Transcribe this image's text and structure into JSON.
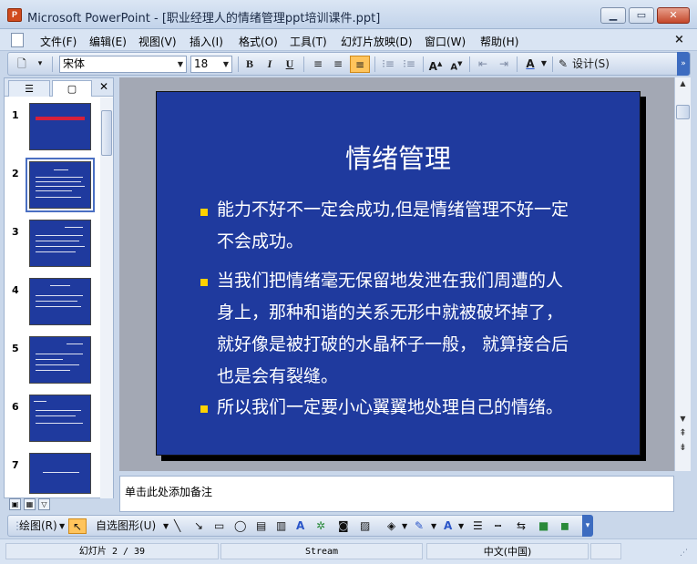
{
  "window": {
    "title": "Microsoft PowerPoint - [职业经理人的情绪管理ppt培训课件.ppt]",
    "app_icon_text": "P"
  },
  "menu": {
    "items": [
      "文件(F)",
      "编辑(E)",
      "视图(V)",
      "插入(I)",
      "格式(O)",
      "工具(T)",
      "幻灯片放映(D)",
      "窗口(W)",
      "帮助(H)"
    ]
  },
  "toolbar": {
    "font_name": "宋体",
    "font_size": "18",
    "bold": "B",
    "italic": "I",
    "underline": "U",
    "design_label": "设计(S)"
  },
  "slide_panel": {
    "tabs": [
      "outline",
      "slides"
    ],
    "slides": [
      {
        "num": "1",
        "active": false
      },
      {
        "num": "2",
        "active": true
      },
      {
        "num": "3",
        "active": false
      },
      {
        "num": "4",
        "active": false
      },
      {
        "num": "5",
        "active": false
      },
      {
        "num": "6",
        "active": false
      },
      {
        "num": "7",
        "active": false
      }
    ]
  },
  "slide": {
    "title": "情绪管理",
    "bullets": [
      {
        "lines": [
          "能力不好不一定会成功,但是情绪管理不好一定",
          "不会成功。"
        ]
      },
      {
        "lines": [
          "当我们把情绪毫无保留地发泄在我们周遭的人",
          "身上，那种和谐的关系无形中就被破坏掉了，",
          "就好像是被打破的水晶杯子一般， 就算接合后",
          "也是会有裂缝。"
        ]
      },
      {
        "lines": [
          "所以我们一定要小心翼翼地处理自己的情绪。"
        ]
      }
    ],
    "background": "#1f3a9e",
    "bullet_color": "#ffd200"
  },
  "notes": {
    "placeholder": "单击此处添加备注"
  },
  "drawing": {
    "draw_label": "绘图(R)",
    "autoshape_label": "自选图形(U)"
  },
  "status": {
    "slide_info": "幻灯片 2 / 39",
    "design": "Stream",
    "language": "中文(中国)"
  }
}
